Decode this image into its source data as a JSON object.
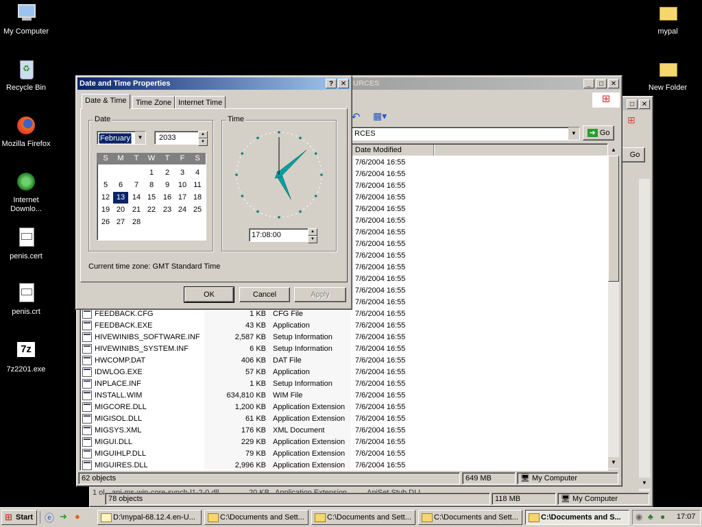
{
  "desktop": {
    "icons": [
      {
        "label": "My Computer"
      },
      {
        "label": "Recycle Bin"
      },
      {
        "label": "Mozilla Firefox"
      },
      {
        "label": "Internet Downlo..."
      },
      {
        "label": "penis.cert"
      },
      {
        "label": "penis.crt"
      },
      {
        "label": "7z2201.exe"
      },
      {
        "label": "mypal"
      },
      {
        "label": "New Folder"
      }
    ]
  },
  "explorer_front": {
    "title": "URCES",
    "address": "RCES",
    "go_label": "Go",
    "columns": {
      "date_modified": "Date Modified"
    },
    "dates_upper": [
      "7/6/2004 16:55",
      "7/6/2004 16:55",
      "7/6/2004 16:55",
      "7/6/2004 16:55",
      "7/6/2004 16:55",
      "7/6/2004 16:55",
      "7/6/2004 16:55",
      "7/6/2004 16:55",
      "7/6/2004 16:55",
      "7/6/2004 16:55",
      "7/6/2004 16:55",
      "7/6/2004 16:55",
      "7/6/2004 16:55"
    ],
    "files": [
      {
        "name": "FEEDBACK.CFG",
        "size": "1 KB",
        "type": "CFG File",
        "date": "7/6/2004 16:55"
      },
      {
        "name": "FEEDBACK.EXE",
        "size": "43 KB",
        "type": "Application",
        "date": "7/6/2004 16:55"
      },
      {
        "name": "HIVEWINIBS_SOFTWARE.INF",
        "size": "2,587 KB",
        "type": "Setup Information",
        "date": "7/6/2004 16:55"
      },
      {
        "name": "HIVEWINIBS_SYSTEM.INF",
        "size": "6 KB",
        "type": "Setup Information",
        "date": "7/6/2004 16:55"
      },
      {
        "name": "HWCOMP.DAT",
        "size": "406 KB",
        "type": "DAT File",
        "date": "7/6/2004 16:55"
      },
      {
        "name": "IDWLOG.EXE",
        "size": "57 KB",
        "type": "Application",
        "date": "7/6/2004 16:55"
      },
      {
        "name": "INPLACE.INF",
        "size": "1 KB",
        "type": "Setup Information",
        "date": "7/6/2004 16:55"
      },
      {
        "name": "INSTALL.WIM",
        "size": "634,810 KB",
        "type": "WIM File",
        "date": "7/6/2004 16:55"
      },
      {
        "name": "MIGCORE.DLL",
        "size": "1,200 KB",
        "type": "Application Extension",
        "date": "7/6/2004 16:55"
      },
      {
        "name": "MIGISOL.DLL",
        "size": "61 KB",
        "type": "Application Extension",
        "date": "7/6/2004 16:55"
      },
      {
        "name": "MIGSYS.XML",
        "size": "176 KB",
        "type": "XML Document",
        "date": "7/6/2004 16:55"
      },
      {
        "name": "MIGUI.DLL",
        "size": "229 KB",
        "type": "Application Extension",
        "date": "7/6/2004 16:55"
      },
      {
        "name": "MIGUIHLP.DLL",
        "size": "79 KB",
        "type": "Application Extension",
        "date": "7/6/2004 16:55"
      },
      {
        "name": "MIGUIRES.DLL",
        "size": "2,996 KB",
        "type": "Application Extension",
        "date": "7/6/2004 16:55"
      }
    ],
    "status": {
      "objects": "62 objects",
      "size": "649 MB",
      "location": "My Computer"
    }
  },
  "explorer_back": {
    "go_label": "Go",
    "partial_row": {
      "prefix": "1 ol",
      "name": "api-ms-win-core-synch-l1-2-0.dll",
      "size": "20 KB",
      "type": "Application Extension",
      "company": "ApiSet Stub DLL"
    },
    "status": {
      "objects": "78 objects",
      "size": "118 MB",
      "location": "My Computer"
    }
  },
  "dialog": {
    "title": "Date and Time Properties",
    "help": "?",
    "close": "✕",
    "tabs": [
      "Date & Time",
      "Time Zone",
      "Internet Time"
    ],
    "date_group": "Date",
    "time_group": "Time",
    "month": "February",
    "year": "2033",
    "weekdays": [
      "S",
      "M",
      "T",
      "W",
      "T",
      "F",
      "S"
    ],
    "weeks": [
      [
        "",
        "",
        "",
        "1",
        "2",
        "3",
        "4"
      ],
      [
        "5",
        "6",
        "7",
        "8",
        "9",
        "10",
        "11"
      ],
      [
        "12",
        "13",
        "14",
        "15",
        "16",
        "17",
        "18"
      ],
      [
        "19",
        "20",
        "21",
        "22",
        "23",
        "24",
        "25"
      ],
      [
        "26",
        "27",
        "28",
        "",
        "",
        "",
        ""
      ]
    ],
    "selected_day": "13",
    "time": "17:08:00",
    "timezone_label": "Current time zone:  GMT Standard Time",
    "ok": "OK",
    "cancel": "Cancel",
    "apply": "Apply"
  },
  "taskbar": {
    "start": "Start",
    "buttons": [
      {
        "label": "D:\\mypal-68.12.4.en-U..."
      },
      {
        "label": "C:\\Documents and Sett..."
      },
      {
        "label": "C:\\Documents and Sett..."
      },
      {
        "label": "C:\\Documents and Sett..."
      },
      {
        "label": "C:\\Documents and S..."
      }
    ],
    "clock": "17:07"
  }
}
